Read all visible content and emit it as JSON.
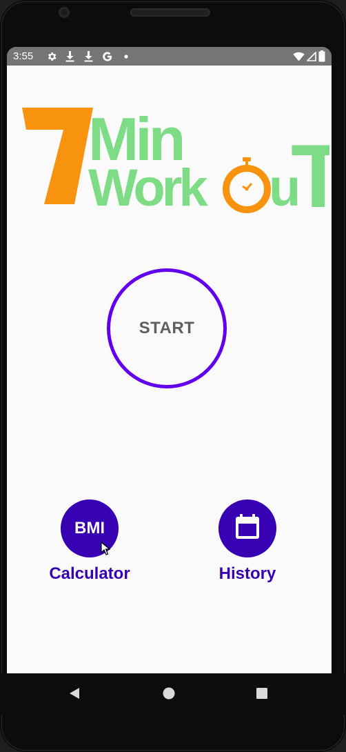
{
  "status_bar": {
    "time": "3:55",
    "left_icons": [
      "gear-icon",
      "download-icon",
      "download-icon",
      "google-g-icon",
      "dot-icon"
    ],
    "right_icons": [
      "wifi-icon",
      "signal-icon",
      "battery-icon"
    ],
    "background": "#757575"
  },
  "logo": {
    "number": "7",
    "word_top": "Min",
    "word_bottom_left": "Work",
    "word_bottom_u": "u",
    "word_bottom_t": "T",
    "number_color": "#f7930f",
    "text_color": "#7fdc86",
    "stopwatch_color": "#f7930f"
  },
  "start": {
    "label": "START",
    "ring_color": "#6200ee"
  },
  "bmi": {
    "button_label": "BMI",
    "caption": "Calculator",
    "color": "#3700b3"
  },
  "history": {
    "icon": "calendar-icon",
    "caption": "History",
    "color": "#3700b3"
  },
  "nav_bar": {
    "buttons": [
      "back-icon",
      "home-icon",
      "recents-icon"
    ]
  }
}
